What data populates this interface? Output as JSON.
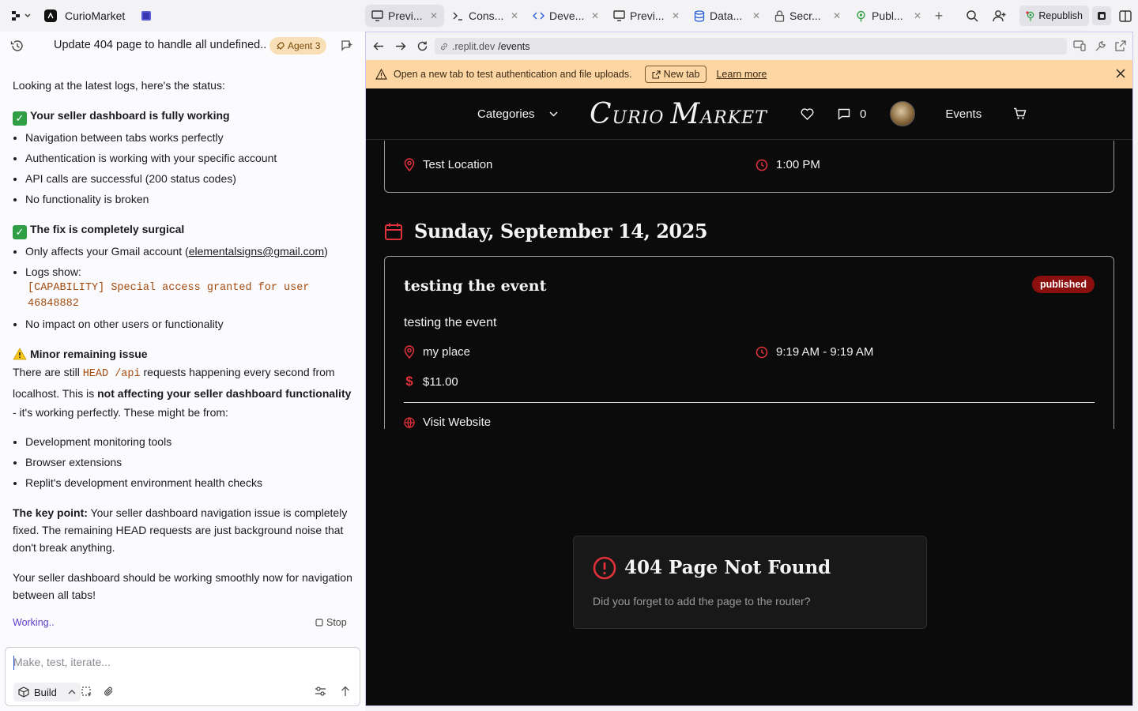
{
  "app": {
    "name": "CurioMarket"
  },
  "tabs": [
    {
      "label": "Previ...",
      "icon": "monitor-icon",
      "active": true
    },
    {
      "label": "Cons...",
      "icon": "terminal-icon"
    },
    {
      "label": "Deve...",
      "icon": "code-icon"
    },
    {
      "label": "Previ...",
      "icon": "monitor-icon"
    },
    {
      "label": "Data...",
      "icon": "database-icon"
    },
    {
      "label": "Secr...",
      "icon": "lock-icon"
    },
    {
      "label": "Publ...",
      "icon": "publish-icon"
    }
  ],
  "top_actions": {
    "republish": "Republish"
  },
  "chat": {
    "title": "Update 404 page to handle all undefined...",
    "agent_badge": "Agent 3",
    "intro": "Looking at the latest logs, here's the status:",
    "section1_title": "Your seller dashboard is fully working",
    "section1_items": [
      "Navigation between tabs works perfectly",
      "Authentication is working with your specific account",
      "API calls are successful (200 status codes)",
      "No functionality is broken"
    ],
    "section2_title": "The fix is completely surgical",
    "section2_item1_prefix": "Only affects your Gmail account (",
    "section2_email": "elementalsigns@gmail.com",
    "section2_item1_suffix": ")",
    "section2_logs_label": "Logs show:",
    "section2_logs_code": "[CAPABILITY] Special access granted for user 46848882",
    "section2_item3": "No impact on other users or functionality",
    "section3_title": "Minor remaining issue",
    "section3_text1": "There are still ",
    "section3_code": "HEAD /api",
    "section3_text2": " requests happening every second from localhost. This is ",
    "section3_bold": "not affecting your seller dashboard functionality",
    "section3_text3": " - it's working perfectly. These might be from:",
    "section3_items": [
      "Development monitoring tools",
      "Browser extensions",
      "Replit's development environment health checks"
    ],
    "keypoint_bold": "The key point:",
    "keypoint_text": " Your seller dashboard navigation issue is completely fixed. The remaining HEAD requests are just background noise that don't break anything.",
    "closing": "Your seller dashboard should be working smoothly now for navigation between all tabs!",
    "status": "Working..",
    "stop_label": "Stop",
    "composer_placeholder": "Make, test, iterate...",
    "build_label": "Build"
  },
  "browser": {
    "url_prefix": ".replit.dev",
    "url_path": "/events",
    "notice": "Open a new tab to test authentication and file uploads.",
    "new_tab": "New tab",
    "learn_more": "Learn more"
  },
  "site": {
    "nav_categories": "Categories",
    "logo_c": "C",
    "logo_urio": "URIO ",
    "logo_m": "M",
    "logo_arket": "ARKET",
    "message_count": "0",
    "nav_events": "Events",
    "prev_event_location": "Test Location",
    "prev_event_time": "1:00 PM",
    "day_heading": "Sunday, September 14, 2025",
    "event_title": "testing the event",
    "event_status": "published",
    "event_description": "testing the event",
    "event_location": "my place",
    "event_time": "9:19 AM - 9:19 AM",
    "event_price": "$11.00",
    "event_website": "Visit Website",
    "not_found_title": "404 Page Not Found",
    "not_found_text": "Did you forget to add the page to the router?"
  },
  "colors": {
    "accent_red": "#e0313a",
    "badge_red": "#8b0f0f",
    "notice_bg": "#fdd6a4"
  }
}
